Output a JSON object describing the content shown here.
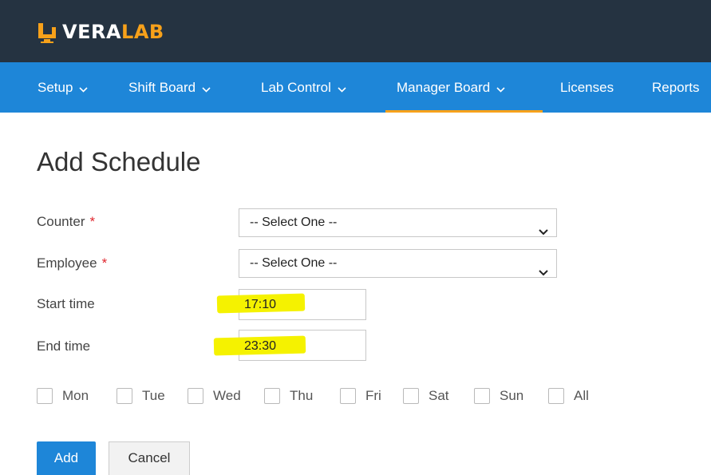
{
  "brand": {
    "name_part1": "VERA",
    "name_part2": "LAB",
    "accent_color": "#f7a11a",
    "topbar_color": "#253341",
    "nav_color": "#1e86d8"
  },
  "nav": {
    "items": [
      {
        "label": "Setup",
        "has_dropdown": true,
        "icon": "chevron-down-icon"
      },
      {
        "label": "Shift Board",
        "has_dropdown": true,
        "icon": "chevron-down-icon"
      },
      {
        "label": "Lab Control",
        "has_dropdown": true,
        "icon": "chevron-down-icon"
      },
      {
        "label": "Manager Board",
        "has_dropdown": true,
        "icon": "chevron-down-icon",
        "active": true
      },
      {
        "label": "Licenses",
        "has_dropdown": false
      },
      {
        "label": "Reports",
        "has_dropdown": false
      }
    ]
  },
  "page": {
    "title": "Add Schedule"
  },
  "form": {
    "counter": {
      "label": "Counter",
      "required_mark": "*",
      "selected": "-- Select One --"
    },
    "employee": {
      "label": "Employee",
      "required_mark": "*",
      "selected": "-- Select One --"
    },
    "start_time": {
      "label": "Start time",
      "value": "17:10"
    },
    "end_time": {
      "label": "End time",
      "value": "23:30"
    },
    "highlight_color": "#f5f200",
    "days": [
      {
        "label": "Mon",
        "checked": false
      },
      {
        "label": "Tue",
        "checked": false
      },
      {
        "label": "Wed",
        "checked": false
      },
      {
        "label": "Thu",
        "checked": false
      },
      {
        "label": "Fri",
        "checked": false
      },
      {
        "label": "Sat",
        "checked": false
      },
      {
        "label": "Sun",
        "checked": false
      },
      {
        "label": "All",
        "checked": false
      }
    ]
  },
  "actions": {
    "add_label": "Add",
    "cancel_label": "Cancel"
  }
}
